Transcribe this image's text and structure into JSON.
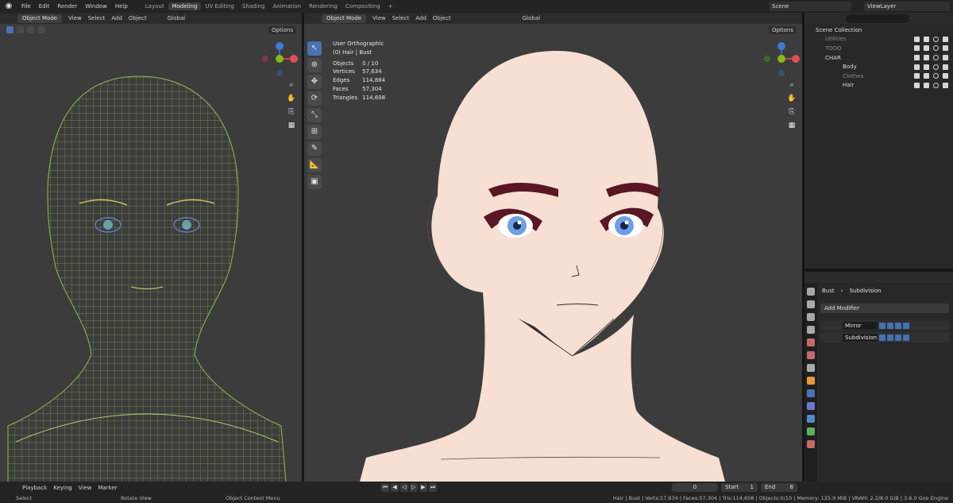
{
  "topbar": {
    "menus": [
      "File",
      "Edit",
      "Render",
      "Window",
      "Help"
    ],
    "workspaces": [
      "Layout",
      "Modeling",
      "UV Editing",
      "Shading",
      "Animation",
      "Rendering",
      "Compositing",
      "+"
    ],
    "active_workspace": "Modeling",
    "scene": "Scene",
    "view_layer": "ViewLayer"
  },
  "left_viewport": {
    "mode": "Object Mode",
    "menus": [
      "View",
      "Select",
      "Add",
      "Object"
    ],
    "orientation": "Global",
    "options": "Options"
  },
  "main_viewport": {
    "mode": "Object Mode",
    "menus": [
      "View",
      "Select",
      "Add",
      "Object"
    ],
    "orientation": "Global",
    "options": "Options",
    "view_name": "User Orthographic",
    "context": "(0) Hair | Bust",
    "stats": [
      {
        "label": "Objects",
        "value": "0 / 10"
      },
      {
        "label": "Vertices",
        "value": "57,634"
      },
      {
        "label": "Edges",
        "value": "114,884"
      },
      {
        "label": "Faces",
        "value": "57,304"
      },
      {
        "label": "Triangles",
        "value": "114,608"
      }
    ]
  },
  "outliner": {
    "items": [
      {
        "name": "Scene Collection",
        "dim": false
      },
      {
        "name": "Utilities",
        "dim": true
      },
      {
        "name": "TODO",
        "dim": true
      },
      {
        "name": "CHAR",
        "dim": false
      },
      {
        "name": "Body",
        "dim": false
      },
      {
        "name": "Clothes",
        "dim": true
      },
      {
        "name": "Hair",
        "dim": false
      }
    ]
  },
  "properties": {
    "object": "Bust",
    "modifier_context": "Subdivision",
    "add_modifier": "Add Modifier",
    "modifiers": [
      "Mirror",
      "Subdivision"
    ]
  },
  "timeline": {
    "menus": [
      "Playback",
      "Keying",
      "View",
      "Marker"
    ],
    "current_frame": "0",
    "start_label": "Start",
    "start_value": "1",
    "end_label": "End",
    "end_value": "8"
  },
  "statusbar": {
    "select": "Select",
    "rotate": "Rotate View",
    "context_menu": "Object Context Menu",
    "stats": "Hair | Bust | Verts:57,634 | Faces:57,304 | Tris:114,608 | Objects:0/10 | Memory: 125.9 MiB | VRAM: 2.2/8.0 GiB | 3.6.0 Goo Engine"
  },
  "colors": {
    "accent": "#4772b3",
    "axis_x": "#e34d57",
    "axis_y": "#86b817",
    "axis_z": "#3c78d4",
    "skin": "#f7dfd4",
    "wire": "#7fb04a"
  }
}
